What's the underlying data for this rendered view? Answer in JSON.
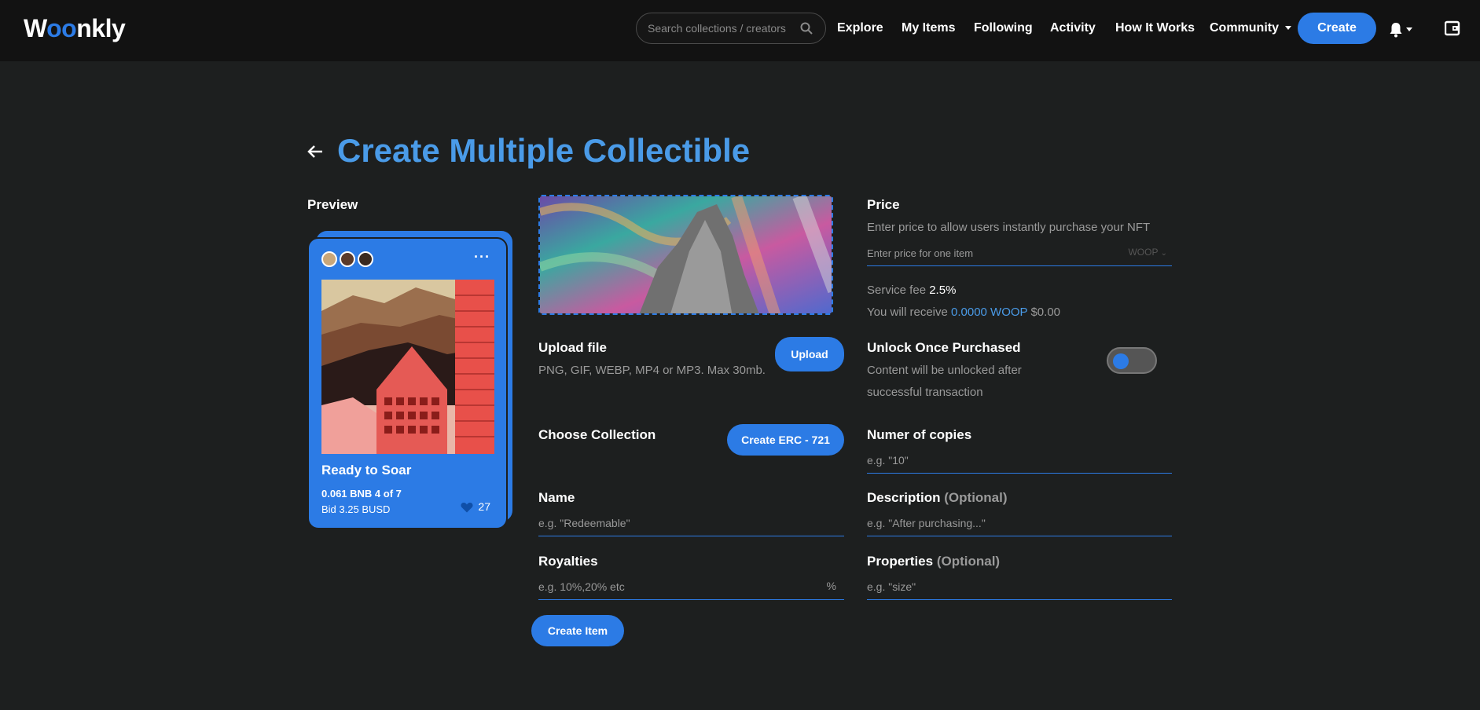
{
  "header": {
    "logo": "Woonkly",
    "search_placeholder": "Search collections / creators",
    "nav": [
      "Explore",
      "My Items",
      "Following",
      "Activity",
      "How It Works",
      "Community"
    ],
    "create_label": "Create"
  },
  "page": {
    "title": "Create Multiple Collectible"
  },
  "preview": {
    "label": "Preview",
    "card": {
      "title": "Ready to Soar",
      "price": "0.061 BNB 4 of 7",
      "bid": "Bid 3.25 BUSD",
      "likes": "27",
      "menu": "···"
    }
  },
  "upload": {
    "label": "Upload file",
    "hint": "PNG, GIF, WEBP, MP4 or MP3. Max 30mb.",
    "button": "Upload"
  },
  "collection": {
    "label": "Choose Collection",
    "button": "Create ERC - 721"
  },
  "name": {
    "label": "Name",
    "placeholder": "e.g. \"Redeemable\""
  },
  "royalties": {
    "label": "Royalties",
    "placeholder": "e.g. 10%,20% etc",
    "suffix": "%"
  },
  "create_item_button": "Create Item",
  "price": {
    "label": "Price",
    "hint": "Enter price to allow users instantly purchase your NFT",
    "placeholder": "Enter price for one item",
    "currency": "WOOP",
    "service_fee_label": "Service fee",
    "service_fee_value": "2.5%",
    "receive_label": "You will receive",
    "receive_value": "0.0000 WOOP",
    "receive_usd": "$0.00"
  },
  "unlock": {
    "label": "Unlock Once Purchased",
    "hint_line1": "Content will be unlocked after",
    "hint_line2": "successful transaction",
    "enabled": false
  },
  "copies": {
    "label": "Numer of copies",
    "placeholder": "e.g. \"10\""
  },
  "description": {
    "label": "Description",
    "optional": "(Optional)",
    "placeholder": "e.g. \"After purchasing...\""
  },
  "properties": {
    "label": "Properties",
    "optional": "(Optional)",
    "placeholder": "e.g. \"size\""
  },
  "colors": {
    "accent": "#2c7be5",
    "title": "#4a9be8",
    "background": "#1d1f1f",
    "topbar": "#121212"
  }
}
